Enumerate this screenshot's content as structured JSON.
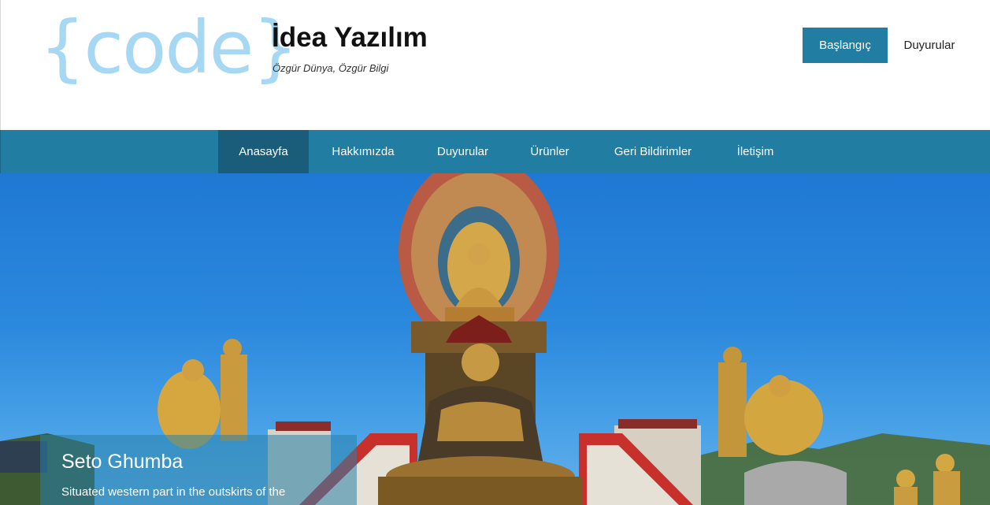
{
  "header": {
    "logo_text": "{code}",
    "title": "İdea Yazılım",
    "tagline": "Özgür Dünya, Özgür Bilgi",
    "start_button": "Başlangıç",
    "announcements_link": "Duyurular"
  },
  "nav": {
    "items": [
      {
        "label": "Anasayfa",
        "active": true
      },
      {
        "label": "Hakkımızda"
      },
      {
        "label": "Duyurular"
      },
      {
        "label": "Ürünler"
      },
      {
        "label": "Geri Bildirimler"
      },
      {
        "label": "İletişim"
      }
    ]
  },
  "hero": {
    "caption_title": "Seto Ghumba",
    "caption_text": "Situated western part in the outskirts of the"
  },
  "colors": {
    "brand": "#227da2",
    "nav_active": "#1a5d7a",
    "logo": "#a6d8f3",
    "sky": "#2a88dd"
  }
}
